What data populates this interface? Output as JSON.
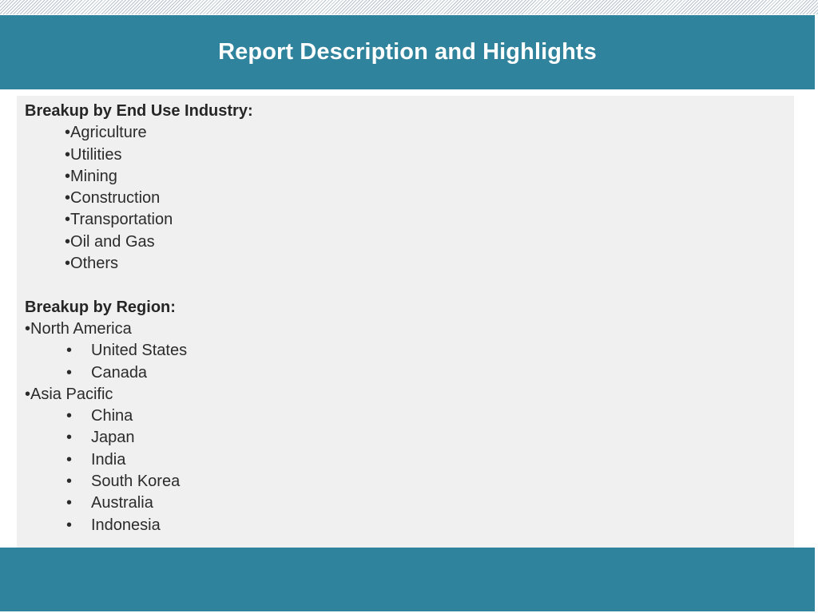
{
  "title": "Report Description and Highlights",
  "end_use": {
    "heading": "Breakup by End Use Industry:",
    "items": [
      "Agriculture",
      "Utilities",
      "Mining",
      "Construction",
      "Transportation",
      "Oil and Gas",
      "Others"
    ]
  },
  "region": {
    "heading": "Breakup by Region:",
    "groups": [
      {
        "name": "North America",
        "countries": [
          "United States",
          "Canada"
        ]
      },
      {
        "name": "Asia Pacific",
        "countries": [
          "China",
          "Japan",
          "India",
          "South Korea",
          "Australia",
          "Indonesia"
        ]
      }
    ]
  },
  "bullet": "•",
  "colors": {
    "header": "#2f839c",
    "panel": "#f0f0f0",
    "title_text": "#ffffff"
  }
}
